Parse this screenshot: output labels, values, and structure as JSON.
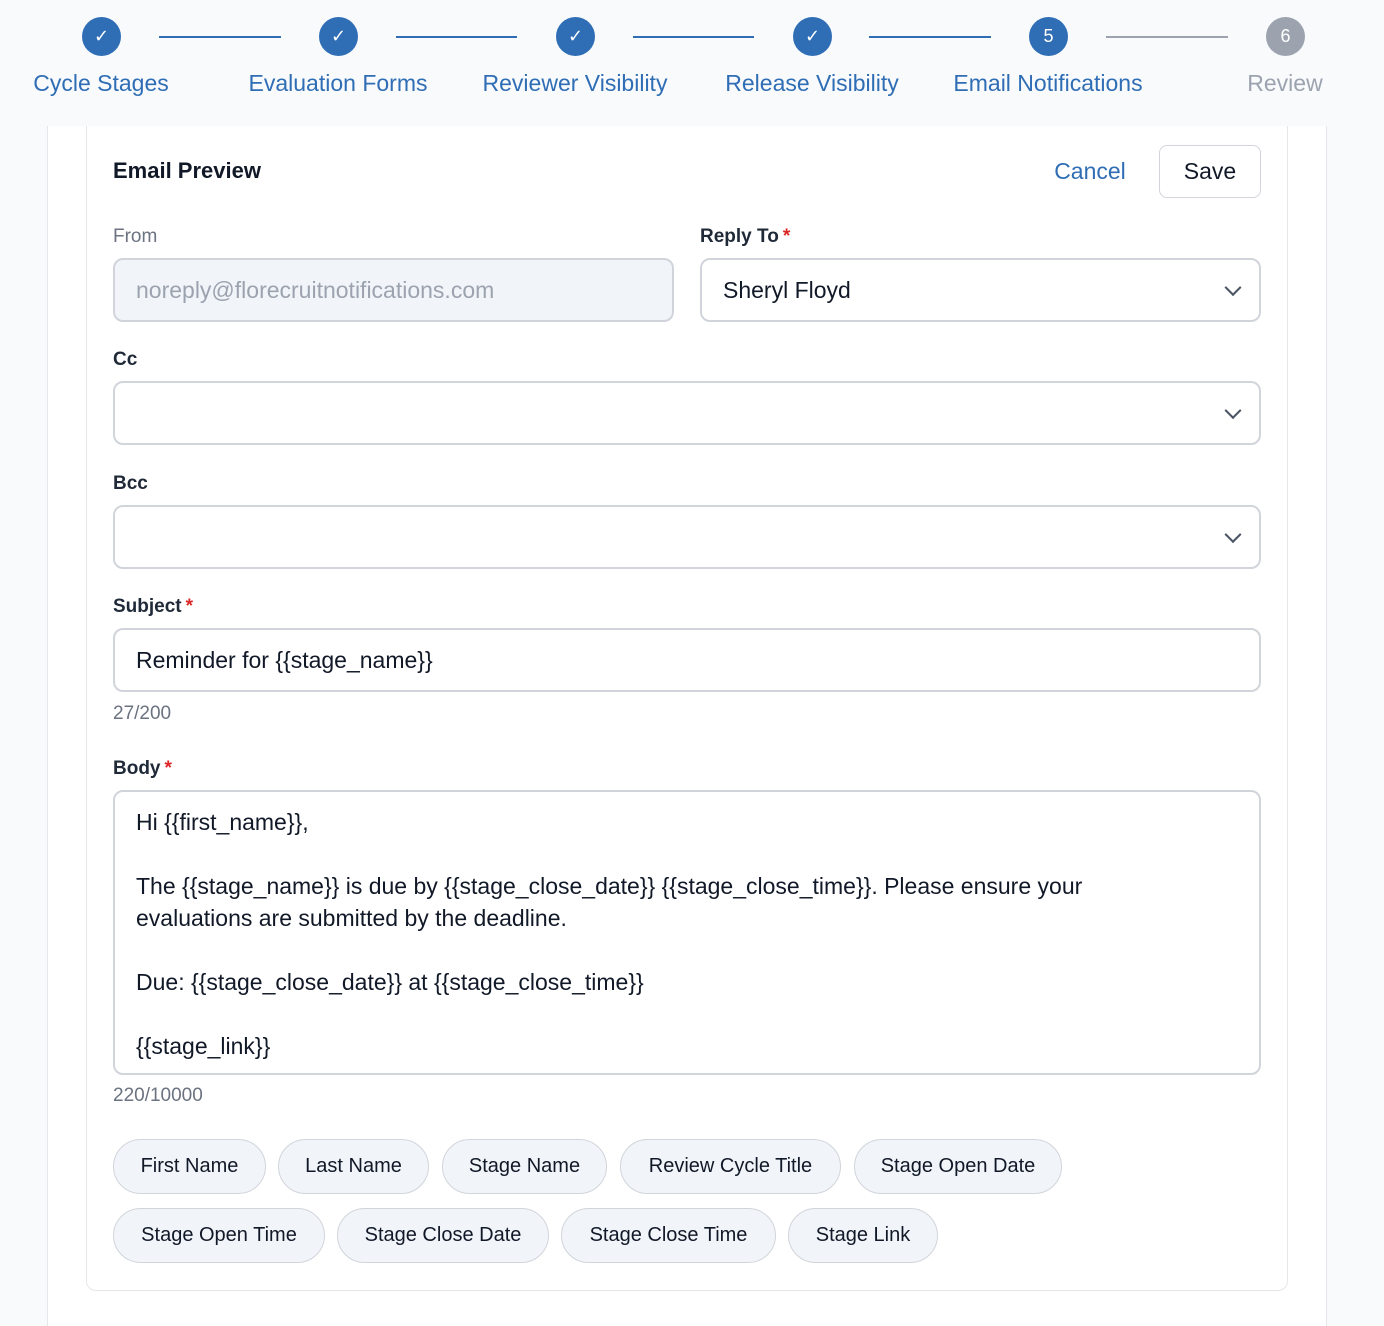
{
  "stepper": {
    "steps": [
      {
        "label": "Cycle Stages",
        "number": "",
        "state": "done"
      },
      {
        "label": "Evaluation Forms",
        "number": "",
        "state": "done"
      },
      {
        "label": "Reviewer Visibility",
        "number": "",
        "state": "done"
      },
      {
        "label": "Release Visibility",
        "number": "",
        "state": "done"
      },
      {
        "label": "Email Notifications",
        "number": "5",
        "state": "active"
      },
      {
        "label": "Review",
        "number": "6",
        "state": "todo"
      }
    ],
    "check_glyph": "✓"
  },
  "header": {
    "title": "Email Preview",
    "cancel_label": "Cancel",
    "save_label": "Save"
  },
  "form": {
    "from": {
      "label": "From",
      "value": "noreply@florecruitnotifications.com"
    },
    "reply_to": {
      "label": "Reply To",
      "required_mark": "*",
      "value": "Sheryl Floyd"
    },
    "cc": {
      "label": "Cc",
      "value": ""
    },
    "bcc": {
      "label": "Bcc",
      "value": ""
    },
    "subject": {
      "label": "Subject",
      "required_mark": "*",
      "value": "Reminder for {{stage_name}}",
      "counter": "27/200"
    },
    "body": {
      "label": "Body",
      "required_mark": "*",
      "value": "Hi {{first_name}},\n\nThe {{stage_name}} is due by {{stage_close_date}} {{stage_close_time}}. Please ensure your\nevaluations are submitted by the deadline.\n\nDue: {{stage_close_date}} at {{stage_close_time}}\n\n{{stage_link}}",
      "counter": "220/10000"
    }
  },
  "variables": [
    "First Name",
    "Last Name",
    "Stage Name",
    "Review Cycle Title",
    "Stage Open Date",
    "Stage Open Time",
    "Stage Close Date",
    "Stage Close Time",
    "Stage Link"
  ],
  "colors": {
    "accent": "#2f6db5",
    "inactive": "#9ca3af",
    "required": "#dc2626"
  }
}
